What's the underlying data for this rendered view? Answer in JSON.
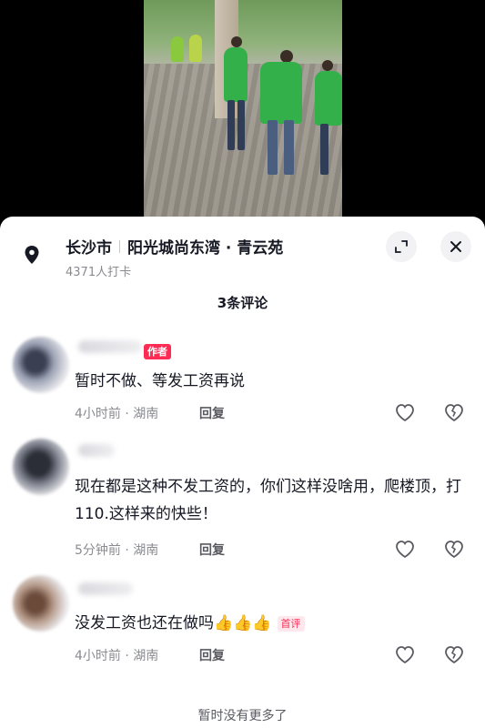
{
  "location": {
    "icon": "location-pin-icon",
    "city": "长沙市",
    "place": "阳光城尚东湾 · 青云苑",
    "checkins": "4371人打卡"
  },
  "header_buttons": {
    "expand_icon": "expand-icon",
    "close_icon": "close-icon"
  },
  "comments_header": "3条评论",
  "comments": [
    {
      "author_tag": "作者",
      "text": "暂时不做、等发工资再说",
      "meta": "4小时前 · 湖南",
      "reply": "回复"
    },
    {
      "author_tag": "",
      "text": "现在都是这种不发工资的，你们这样没啥用，爬楼顶，打110.这样来的快些！",
      "meta": "5分钟前 · 湖南",
      "reply": "回复"
    },
    {
      "author_tag": "",
      "text": "没发工资也还在做吗",
      "emojis": "👍👍👍",
      "first_tag": "首评",
      "meta": "4小时前 · 湖南",
      "reply": "回复"
    }
  ],
  "footer": "暂时没有更多了",
  "colors": {
    "accent": "#fe2c55",
    "text": "#161823",
    "muted": "#8a8b91"
  }
}
